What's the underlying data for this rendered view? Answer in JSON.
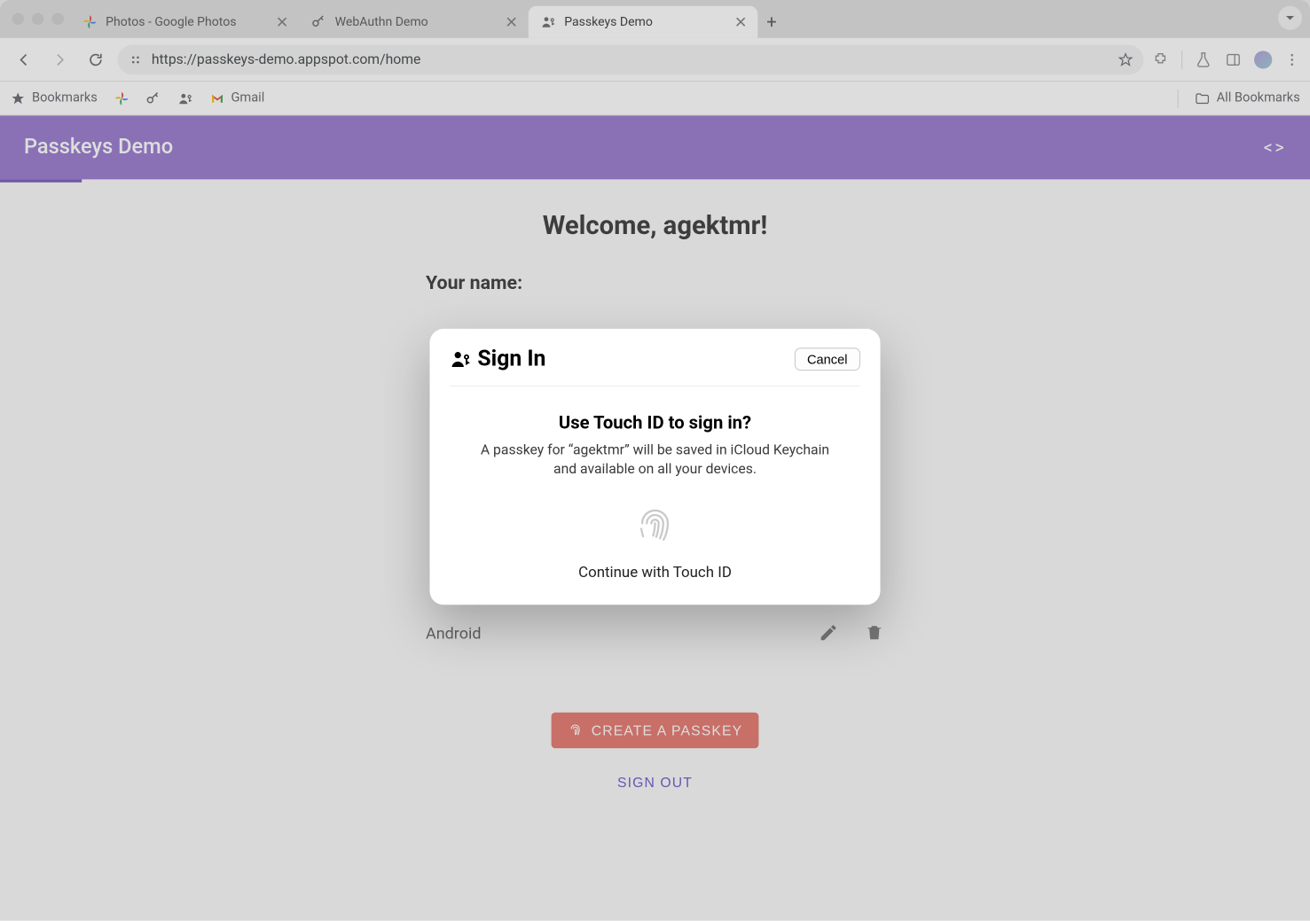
{
  "browser": {
    "tabs": [
      {
        "title": "Photos - Google Photos",
        "favicon": "google-photos"
      },
      {
        "title": "WebAuthn Demo",
        "favicon": "key"
      },
      {
        "title": "Passkeys Demo",
        "favicon": "person-key",
        "active": true
      }
    ],
    "url": "https://passkeys-demo.appspot.com/home",
    "bookmarks_label": "Bookmarks",
    "gmail_label": "Gmail",
    "all_bookmarks_label": "All Bookmarks"
  },
  "page": {
    "app_title": "Passkeys Demo",
    "welcome": "Welcome, agektmr!",
    "name_label": "Your name:",
    "device_row": {
      "label": "Android"
    },
    "create_button": "Create a Passkey",
    "signout_button": "Sign Out"
  },
  "modal": {
    "signin_label": "Sign In",
    "cancel_label": "Cancel",
    "question": "Use Touch ID to sign in?",
    "description": "A passkey for “agektmr” will be saved in iCloud Keychain and available on all your devices.",
    "continue_label": "Continue with Touch ID"
  }
}
